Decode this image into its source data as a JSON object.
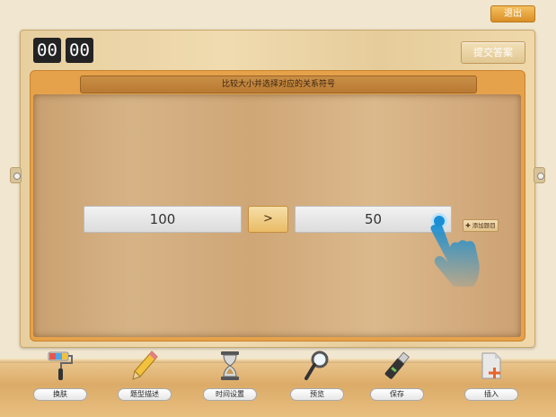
{
  "exit_label": "退出",
  "timer": {
    "minutes": "00",
    "seconds": "00"
  },
  "submit_label": "提交答案",
  "question_title": "比较大小并选择对应的关系符号",
  "compare": {
    "left_value": "100",
    "operator": ">",
    "right_value": "50"
  },
  "add_question_label": "✚ 添加题目",
  "colors": {
    "accent": "#1a8fd6",
    "frame": "#e6a24a",
    "exit": "#e09a30"
  },
  "toolbar": [
    {
      "label": "换肤",
      "icon": "paint-roller-icon"
    },
    {
      "label": "题型描述",
      "icon": "pencil-icon"
    },
    {
      "label": "时间设置",
      "icon": "hourglass-icon"
    },
    {
      "label": "预览",
      "icon": "magnifier-icon"
    },
    {
      "label": "保存",
      "icon": "usb-drive-icon"
    },
    {
      "label": "插入",
      "icon": "insert-file-icon"
    }
  ]
}
